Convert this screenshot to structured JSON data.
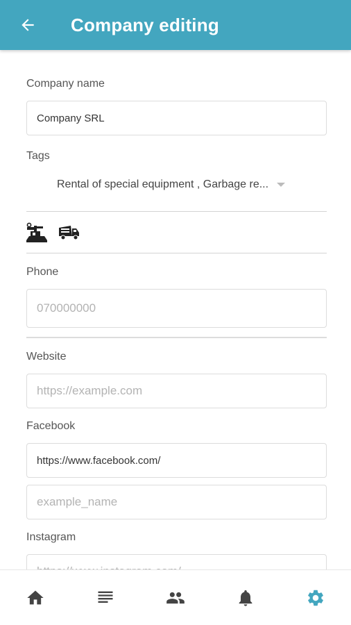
{
  "appbar": {
    "title": "Company editing",
    "back_icon": "arrow-left-icon"
  },
  "form": {
    "company_name": {
      "label": "Company name",
      "value": "Company SRL"
    },
    "tags": {
      "label": "Tags",
      "value": "Rental of special equipment , Garbage re...",
      "icons": [
        "excavator-icon",
        "garbage-truck-icon"
      ]
    },
    "phone": {
      "label": "Phone",
      "placeholder": "070000000",
      "value": ""
    },
    "website": {
      "label": "Website",
      "placeholder": "https://example.com",
      "value": ""
    },
    "facebook": {
      "label": "Facebook",
      "prefix_value": "https://www.facebook.com/",
      "name_placeholder": "example_name"
    },
    "instagram": {
      "label": "Instagram",
      "placeholder": "https://www.instagram.com/"
    }
  },
  "bottom_nav": [
    {
      "name": "home",
      "icon": "home-icon",
      "active": false
    },
    {
      "name": "list",
      "icon": "list-icon",
      "active": false
    },
    {
      "name": "people",
      "icon": "people-icon",
      "active": false
    },
    {
      "name": "notifications",
      "icon": "bell-icon",
      "active": false
    },
    {
      "name": "settings",
      "icon": "gear-icon",
      "active": true
    }
  ],
  "colors": {
    "primary": "#43a6bf",
    "nav_inactive": "#444444",
    "nav_active": "#43a6bf"
  }
}
